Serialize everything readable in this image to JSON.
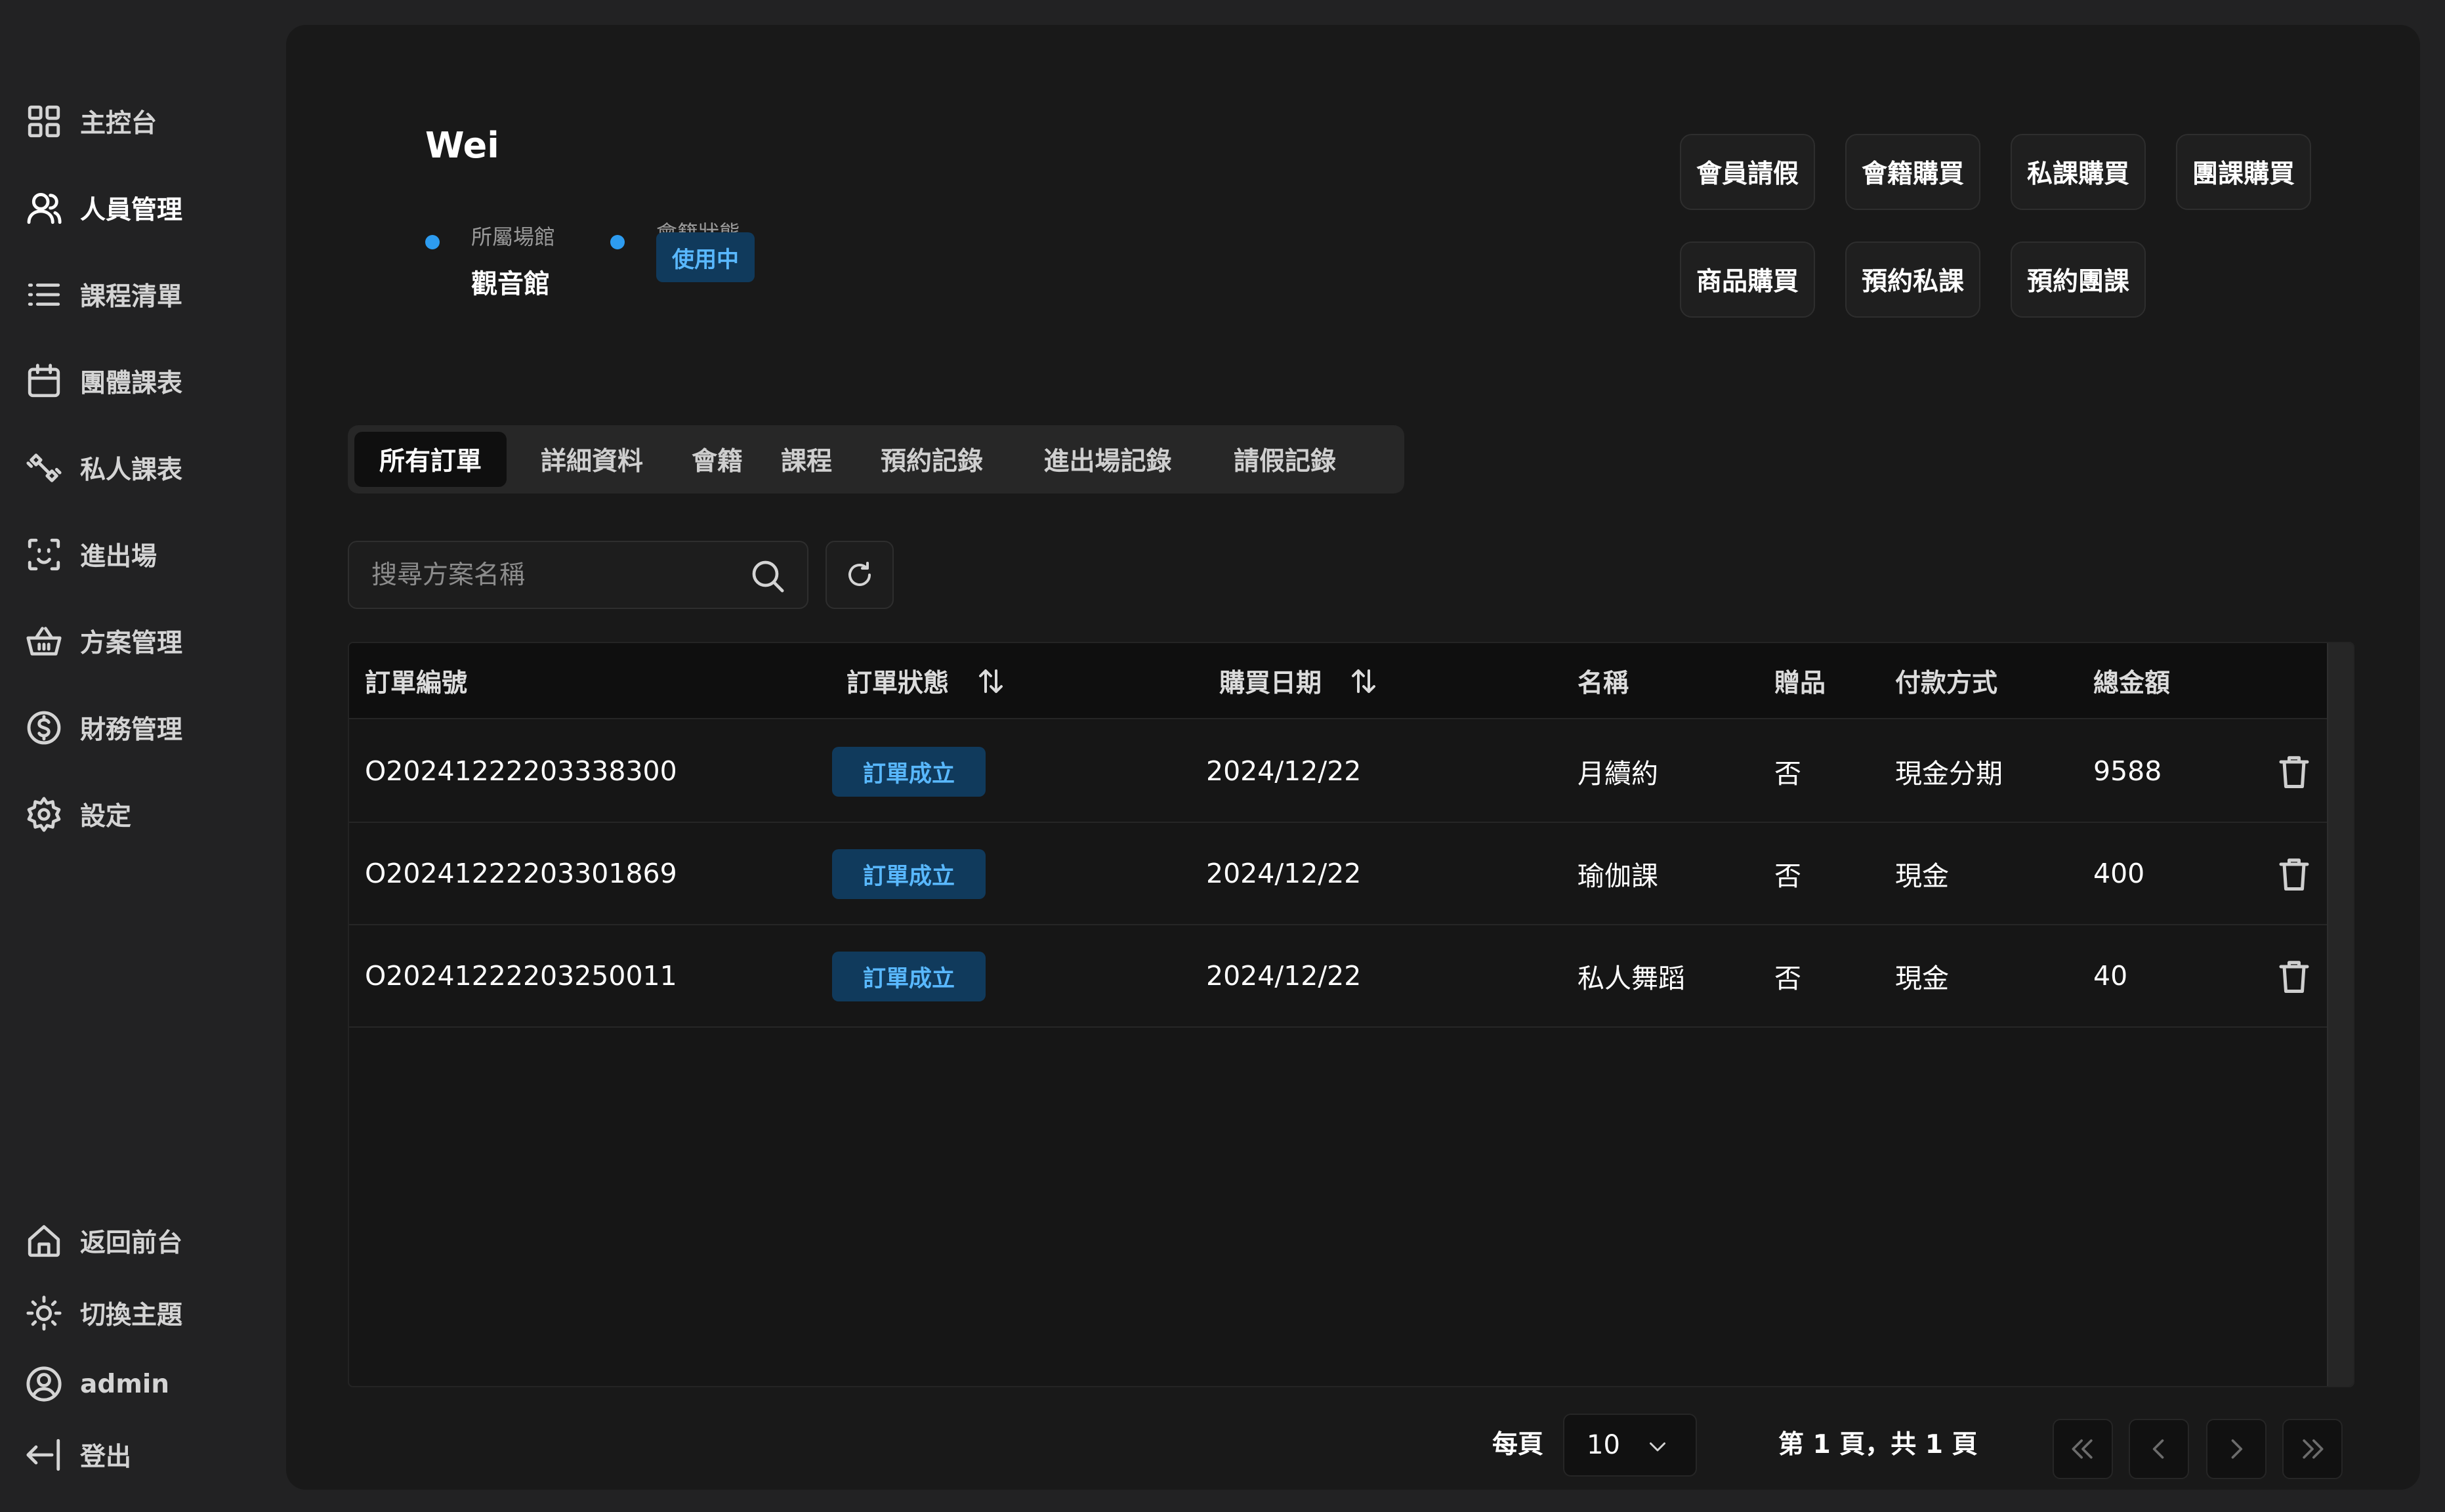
{
  "sidebar": {
    "items": [
      {
        "label": "主控台",
        "icon": "dashboard-icon"
      },
      {
        "label": "人員管理",
        "icon": "user-icon",
        "active": true
      },
      {
        "label": "課程清單",
        "icon": "list-icon"
      },
      {
        "label": "團體課表",
        "icon": "calendar-icon"
      },
      {
        "label": "私人課表",
        "icon": "dumbbell-icon"
      },
      {
        "label": "進出場",
        "icon": "scan-face-icon"
      },
      {
        "label": "方案管理",
        "icon": "basket-icon"
      },
      {
        "label": "財務管理",
        "icon": "dollar-icon"
      },
      {
        "label": "設定",
        "icon": "gear-icon"
      }
    ],
    "bottom": [
      {
        "label": "返回前台",
        "icon": "home-icon"
      },
      {
        "label": "切換主題",
        "icon": "sun-icon"
      },
      {
        "label": "admin",
        "icon": "account-icon"
      },
      {
        "label": "登出",
        "icon": "logout-icon"
      }
    ]
  },
  "profile": {
    "name": "Wei",
    "venue_label": "所屬場館",
    "venue_value": "觀音館",
    "membership_label": "會籍狀態",
    "membership_status": "使用中"
  },
  "actions": [
    "會員請假",
    "會籍購買",
    "私課購買",
    "團課購買",
    "商品購買",
    "預約私課",
    "預約團課"
  ],
  "tabs": [
    "所有訂單",
    "詳細資料",
    "會籍",
    "課程",
    "預約記錄",
    "進出場記錄",
    "請假記錄"
  ],
  "search": {
    "placeholder": "搜尋方案名稱",
    "value": ""
  },
  "table": {
    "headers": [
      "訂單編號",
      "訂單狀態",
      "購買日期",
      "名稱",
      "贈品",
      "付款方式",
      "總金額"
    ],
    "rows": [
      {
        "id": "O20241222203338300",
        "status": "訂單成立",
        "date": "2024/12/22",
        "name": "月續約",
        "gift": "否",
        "payment": "現金分期",
        "total": "9588"
      },
      {
        "id": "O20241222203301869",
        "status": "訂單成立",
        "date": "2024/12/22",
        "name": "瑜伽課",
        "gift": "否",
        "payment": "現金",
        "total": "400"
      },
      {
        "id": "O20241222203250011",
        "status": "訂單成立",
        "date": "2024/12/22",
        "name": "私人舞蹈",
        "gift": "否",
        "payment": "現金",
        "total": "40"
      }
    ]
  },
  "pagination": {
    "per_page_label": "每頁",
    "per_page_value": "10",
    "page_info": "第 1 頁，共 1 頁"
  },
  "colors": {
    "accent": "#2d9cf0",
    "badge_bg": "#103a5c",
    "badge_text": "#59b8ff"
  }
}
